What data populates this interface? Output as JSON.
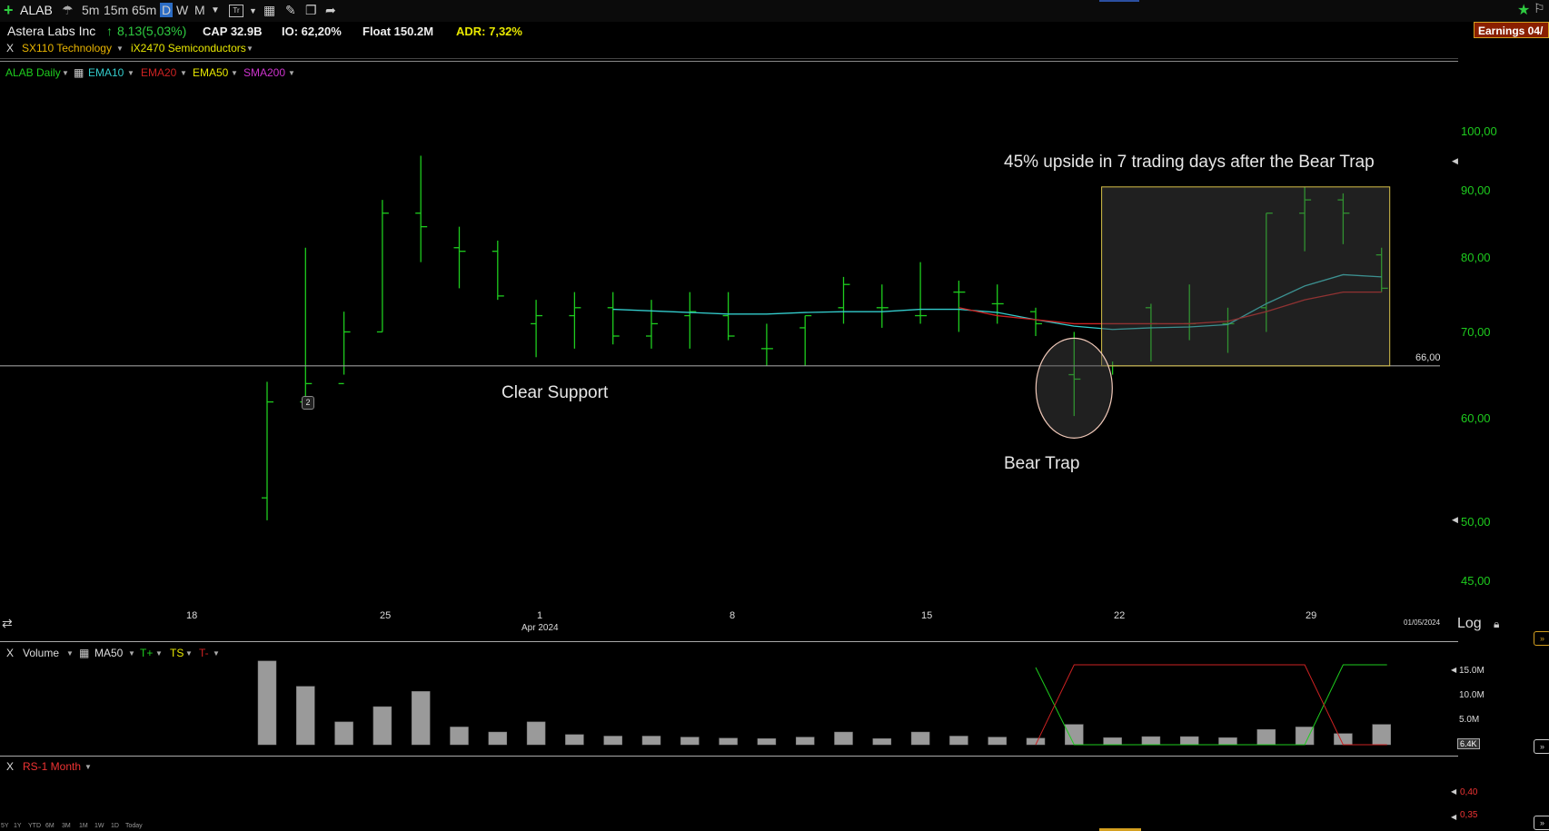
{
  "toolbar": {
    "symbol": "ALAB",
    "intervals": [
      "5m",
      "15m",
      "65m",
      "D",
      "W",
      "M"
    ],
    "earnings": "Earnings 04/"
  },
  "info": {
    "company": "Astera Labs Inc",
    "change": "8,13(5,03%)",
    "cap": "CAP 32.9B",
    "io": "IO: 62,20%",
    "float": "Float 150.2M",
    "adr": "ADR: 7,32%"
  },
  "sectors": {
    "close": "X",
    "sector": "SX110 Technology",
    "industry": "iX2470 Semiconductors"
  },
  "studies": {
    "chart": "ALAB Daily",
    "ema10": "EMA10",
    "ema20": "EMA20",
    "ema50": "EMA50",
    "sma200": "SMA200"
  },
  "annotations": {
    "upside": "45% upside in 7 trading days after the Bear Trap",
    "support": "Clear Support",
    "bear_trap": "Bear Trap",
    "support_level": "66,00",
    "bar_marker": "2"
  },
  "price_axis": {
    "ticks": [
      "100,00",
      "90,00",
      "80,00",
      "70,00",
      "60,00",
      "50,00",
      "45,00"
    ],
    "scale": "Log"
  },
  "date_axis": {
    "ticks": [
      "18",
      "25",
      "1",
      "8",
      "15",
      "22",
      "29"
    ],
    "month": "Apr 2024",
    "last_date": "01/05/2024"
  },
  "volume_panel": {
    "close": "X",
    "title": "Volume",
    "ma": "MA50",
    "tplus": "T+",
    "ts": "TS",
    "tminus": "T-",
    "ticks": [
      "15.0M",
      "10.0M",
      "5.0M"
    ],
    "last": "6.4K"
  },
  "rs_panel": {
    "close": "X",
    "title": "RS-1 Month",
    "ticks": [
      "0,40",
      "0,35"
    ]
  },
  "range_buttons": [
    "5Y",
    "1Y",
    "YTD",
    "6M",
    "3M",
    "1M",
    "1W",
    "1D",
    "Today"
  ],
  "colors": {
    "up": "#1ecc1e",
    "ema10": "#33cccc",
    "ema20": "#cc2222",
    "ema50": "#e8e800",
    "sma200": "#cc33cc",
    "support_line": "#9a9a9a",
    "box_border": "#d8c24a"
  },
  "chart_data": [
    {
      "type": "ohlc",
      "title": "ALAB Daily",
      "y_scale": "log",
      "ylim": [
        43,
        108
      ],
      "bars": [
        {
          "date": "2024-03-20",
          "open": 52.5,
          "high": 64.2,
          "low": 50.5,
          "close": 62.0
        },
        {
          "date": "2024-03-21",
          "open": 62.0,
          "high": 81.0,
          "low": 62.0,
          "close": 64.0
        },
        {
          "date": "2024-03-22",
          "open": 64.0,
          "high": 72.5,
          "low": 65.0,
          "close": 70.0
        },
        {
          "date": "2024-03-25",
          "open": 70.0,
          "high": 88.0,
          "low": 70.0,
          "close": 86.0
        },
        {
          "date": "2024-03-26",
          "open": 86.0,
          "high": 95.0,
          "low": 79.0,
          "close": 84.0
        },
        {
          "date": "2024-03-27",
          "open": 81.0,
          "high": 84.0,
          "low": 75.5,
          "close": 80.5
        },
        {
          "date": "2024-03-28",
          "open": 80.5,
          "high": 82.0,
          "low": 74.0,
          "close": 74.5
        },
        {
          "date": "2024-04-01",
          "open": 71.0,
          "high": 74.0,
          "low": 67.0,
          "close": 72.0
        },
        {
          "date": "2024-04-02",
          "open": 72.0,
          "high": 75.0,
          "low": 68.0,
          "close": 73.0
        },
        {
          "date": "2024-04-03",
          "open": 73.0,
          "high": 75.0,
          "low": 68.5,
          "close": 69.5
        },
        {
          "date": "2024-04-04",
          "open": 69.5,
          "high": 74.0,
          "low": 68.0,
          "close": 71.0
        },
        {
          "date": "2024-04-05",
          "open": 72.0,
          "high": 75.0,
          "low": 68.0,
          "close": 72.5
        },
        {
          "date": "2024-04-08",
          "open": 72.0,
          "high": 75.0,
          "low": 69.0,
          "close": 69.5
        },
        {
          "date": "2024-04-09",
          "open": 68.0,
          "high": 71.0,
          "low": 66.0,
          "close": 68.0
        },
        {
          "date": "2024-04-10",
          "open": 70.5,
          "high": 72.0,
          "low": 66.0,
          "close": 72.0
        },
        {
          "date": "2024-04-11",
          "open": 73.0,
          "high": 77.0,
          "low": 71.0,
          "close": 76.0
        },
        {
          "date": "2024-04-12",
          "open": 73.0,
          "high": 76.0,
          "low": 70.5,
          "close": 73.0
        },
        {
          "date": "2024-04-15",
          "open": 72.0,
          "high": 79.0,
          "low": 71.0,
          "close": 72.0
        },
        {
          "date": "2024-04-16",
          "open": 75.0,
          "high": 76.5,
          "low": 70.0,
          "close": 75.0
        },
        {
          "date": "2024-04-17",
          "open": 73.5,
          "high": 76.0,
          "low": 71.0,
          "close": 73.5
        },
        {
          "date": "2024-04-18",
          "open": 72.5,
          "high": 73.0,
          "low": 69.5,
          "close": 71.0
        },
        {
          "date": "2024-04-19",
          "open": 65.0,
          "high": 70.0,
          "low": 60.5,
          "close": 64.5
        },
        {
          "date": "2024-04-22",
          "open": 66.0,
          "high": 66.5,
          "low": 65.0,
          "close": 66.0
        },
        {
          "date": "2024-04-23",
          "open": 73.0,
          "high": 73.5,
          "low": 66.5,
          "close": 71.0
        },
        {
          "date": "2024-04-24",
          "open": 71.0,
          "high": 76.0,
          "low": 69.0,
          "close": 71.0
        },
        {
          "date": "2024-04-25",
          "open": 71.0,
          "high": 73.0,
          "low": 67.5,
          "close": 71.0
        },
        {
          "date": "2024-04-26",
          "open": 73.0,
          "high": 86.0,
          "low": 70.0,
          "close": 86.0
        },
        {
          "date": "2024-04-29",
          "open": 86.0,
          "high": 90.0,
          "low": 80.5,
          "close": 88.0
        },
        {
          "date": "2024-04-30",
          "open": 88.0,
          "high": 89.0,
          "low": 81.5,
          "close": 86.0
        },
        {
          "date": "2024-05-01",
          "open": 80.0,
          "high": 81.0,
          "low": 75.0,
          "close": 75.5
        }
      ],
      "series": [
        {
          "name": "EMA10",
          "values": [
            72.8,
            72.6,
            72.4,
            72.2,
            72.2,
            72.4,
            72.5,
            72.5,
            72.8,
            72.8,
            72.4,
            71.5,
            70.7,
            70.3,
            70.5,
            70.6,
            70.9,
            73.5,
            75.8,
            77.3,
            77.0
          ]
        },
        {
          "name": "EMA20",
          "values": [
            73.0,
            72.0,
            71.5,
            71.0,
            71.0,
            71.0,
            71.0,
            71.3,
            72.5,
            74.0,
            75.0,
            75.0
          ]
        }
      ],
      "support_level": 66.0
    },
    {
      "type": "bar",
      "title": "Volume",
      "values": [
        16.5,
        11.5,
        4.5,
        7.5,
        10.5,
        3.5,
        2.5,
        4.5,
        2.0,
        1.7,
        1.7,
        1.5,
        1.3,
        1.2,
        1.5,
        2.5,
        1.2,
        2.5,
        1.7,
        1.5,
        1.3,
        4.0,
        1.4,
        1.6,
        1.6,
        1.4,
        3.0,
        3.5,
        2.2,
        4.0
      ],
      "unit": "M",
      "ylim": [
        0,
        17
      ]
    }
  ]
}
